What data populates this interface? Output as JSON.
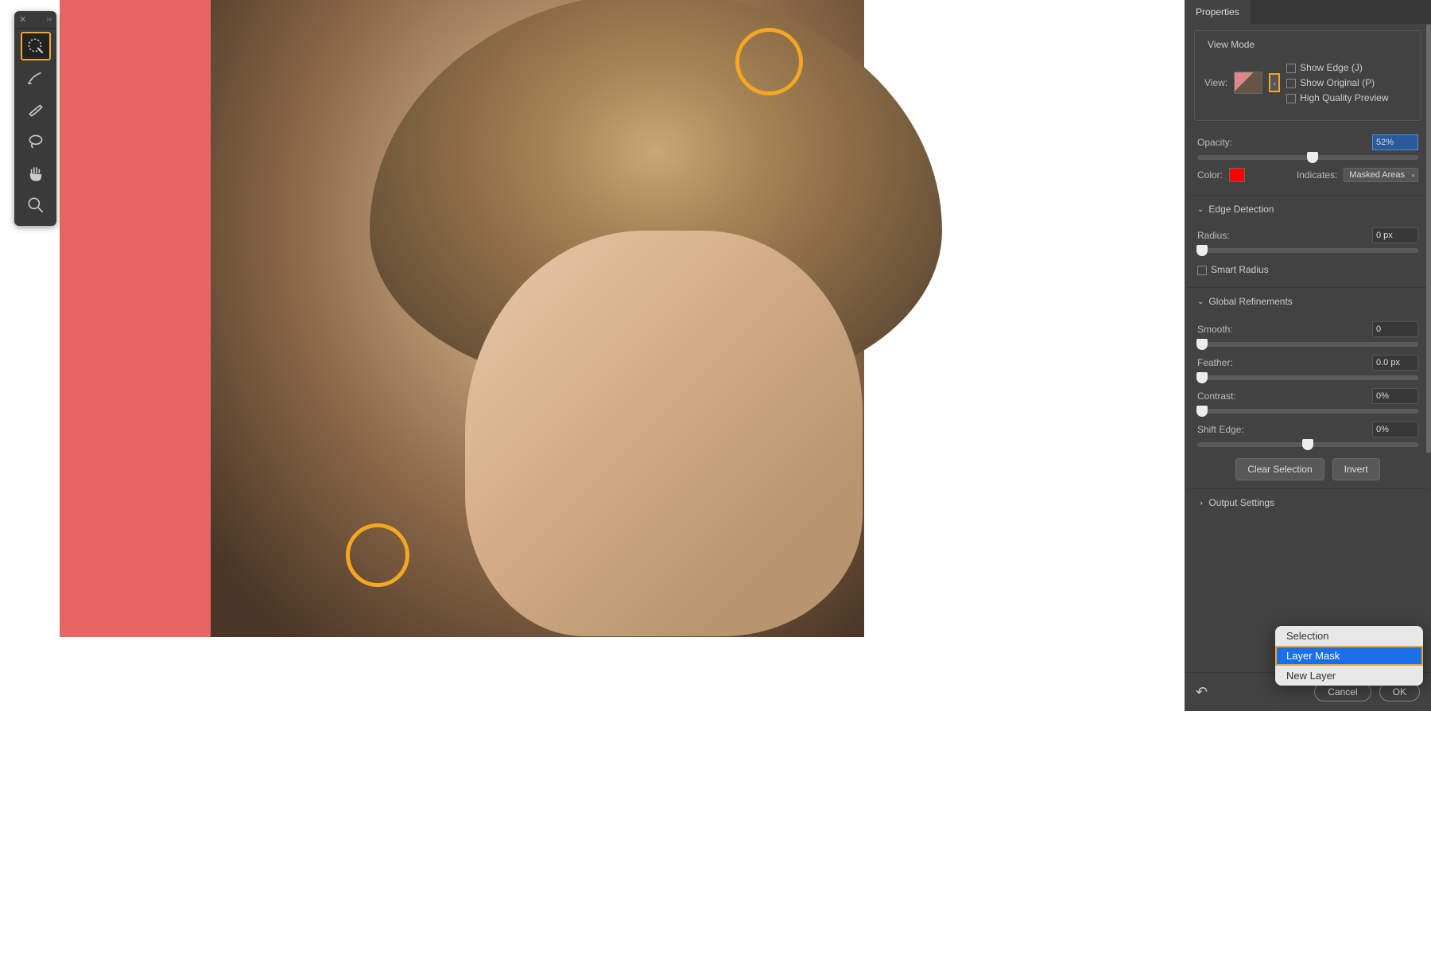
{
  "panel_tab": "Properties",
  "view_mode": {
    "title": "View Mode",
    "view_label": "View:",
    "show_edge": "Show Edge (J)",
    "show_original": "Show Original (P)",
    "hq_preview": "High Quality Preview"
  },
  "opacity": {
    "label": "Opacity:",
    "value": "52%"
  },
  "color": {
    "label": "Color:",
    "indicates": "Indicates:",
    "mode": "Masked Areas"
  },
  "edge_detection": {
    "title": "Edge Detection",
    "radius_label": "Radius:",
    "radius_value": "0 px",
    "smart_radius": "Smart Radius"
  },
  "global": {
    "title": "Global Refinements",
    "smooth_label": "Smooth:",
    "smooth_value": "0",
    "feather_label": "Feather:",
    "feather_value": "0.0 px",
    "contrast_label": "Contrast:",
    "contrast_value": "0%",
    "shift_label": "Shift Edge:",
    "shift_value": "0%",
    "clear": "Clear Selection",
    "invert": "Invert"
  },
  "output": {
    "title": "Output Settings",
    "options": [
      "Selection",
      "Layer Mask",
      "New Layer"
    ]
  },
  "footer": {
    "cancel": "Cancel",
    "ok": "OK"
  }
}
